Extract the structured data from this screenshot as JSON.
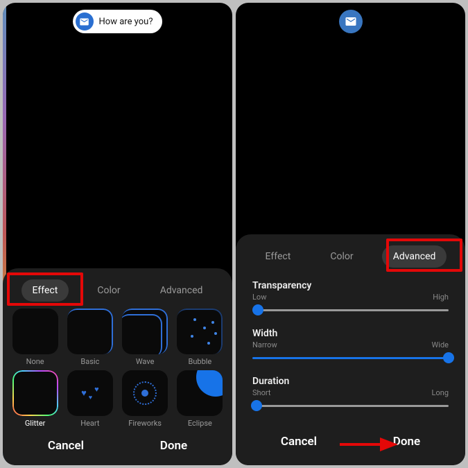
{
  "notification": {
    "text": "How are you?"
  },
  "left": {
    "tabs": [
      "Effect",
      "Color",
      "Advanced"
    ],
    "activeTab": 0,
    "effects": [
      "None",
      "Basic",
      "Wave",
      "Bubble",
      "Glitter",
      "Heart",
      "Fireworks",
      "Eclipse"
    ],
    "selectedEffect": 4,
    "buttons": {
      "cancel": "Cancel",
      "done": "Done"
    }
  },
  "right": {
    "tabs": [
      "Effect",
      "Color",
      "Advanced"
    ],
    "activeTab": 2,
    "sliders": [
      {
        "title": "Transparency",
        "low": "Low",
        "high": "High",
        "value": 0.03
      },
      {
        "title": "Width",
        "low": "Narrow",
        "high": "Wide",
        "value": 1.0
      },
      {
        "title": "Duration",
        "low": "Short",
        "high": "Long",
        "value": 0.02
      }
    ],
    "buttons": {
      "cancel": "Cancel",
      "done": "Done"
    }
  },
  "colors": {
    "accent": "#1773e8",
    "highlight": "#e40808"
  }
}
